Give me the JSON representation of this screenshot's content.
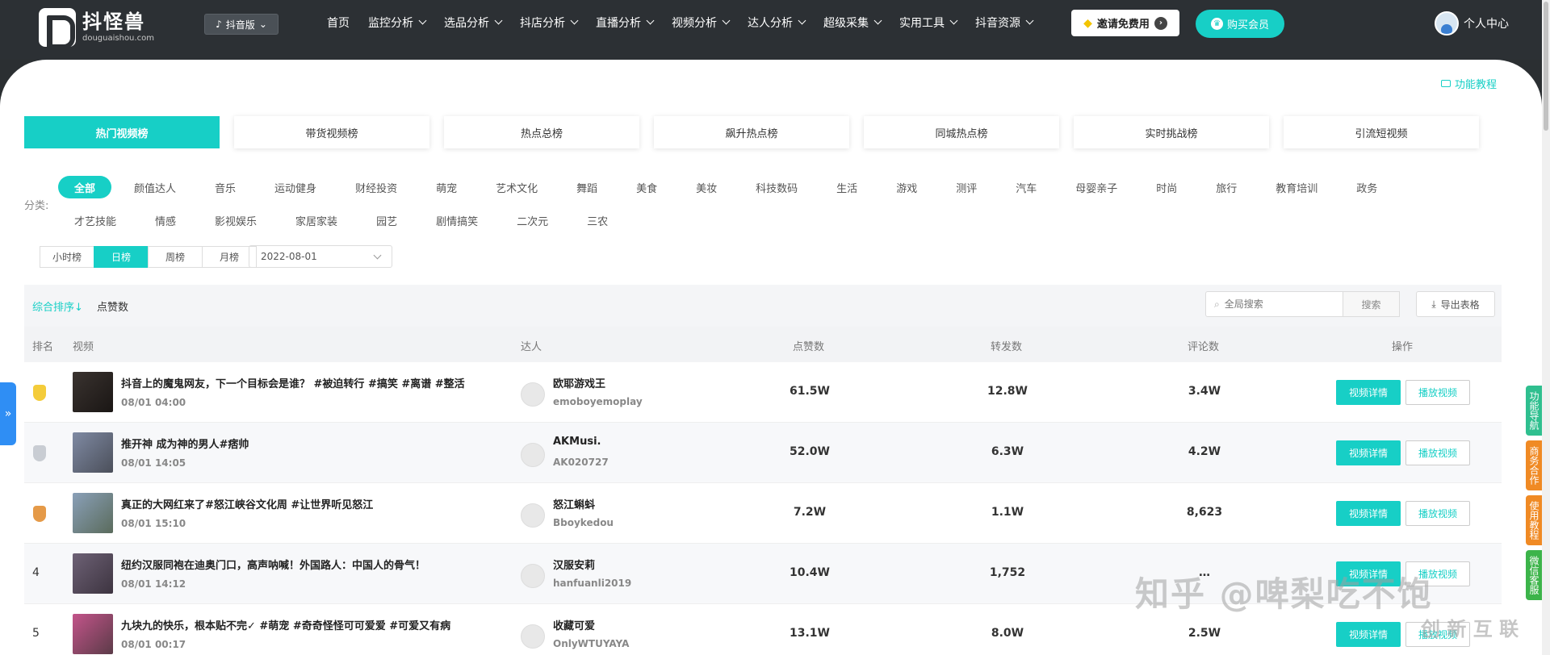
{
  "header": {
    "brand_name": "抖怪兽",
    "brand_url": "douguaishou.com",
    "platform": "抖音版",
    "nav": [
      "首页",
      "监控分析",
      "选品分析",
      "抖店分析",
      "直播分析",
      "视频分析",
      "达人分析",
      "超级采集",
      "实用工具",
      "抖音资源"
    ],
    "nav_has_caret": [
      false,
      true,
      true,
      true,
      true,
      true,
      true,
      true,
      true,
      true
    ],
    "invite_label": "邀请免费用",
    "buy_label": "购买会员",
    "user_label": "个人中心"
  },
  "tutorial_label": "功能教程",
  "rank_tabs": [
    "热门视频榜",
    "带货视频榜",
    "热点总榜",
    "飙升热点榜",
    "同城热点榜",
    "实时挑战榜",
    "引流短视频"
  ],
  "active_rank_tab": 0,
  "category_label": "分类:",
  "categories": [
    "全部",
    "颜值达人",
    "音乐",
    "运动健身",
    "财经投资",
    "萌宠",
    "艺术文化",
    "舞蹈",
    "美食",
    "美妆",
    "科技数码",
    "生活",
    "游戏",
    "测评",
    "汽车",
    "母婴亲子",
    "时尚",
    "旅行",
    "教育培训",
    "政务",
    "才艺技能",
    "情感",
    "影视娱乐",
    "家居家装",
    "园艺",
    "剧情搞笑",
    "二次元",
    "三农"
  ],
  "active_category": 0,
  "periods": [
    "小时榜",
    "日榜",
    "周榜",
    "月榜"
  ],
  "active_period": 1,
  "date_value": "2022-08-01",
  "toolbar": {
    "sort_composite": "综合排序↓",
    "sort_likes": "点赞数",
    "search_placeholder": "全局搜索",
    "search_button": "搜索",
    "export_button": "导出表格"
  },
  "table": {
    "headers": [
      "排名",
      "视频",
      "达人",
      "点赞数",
      "转发数",
      "评论数",
      "操作"
    ],
    "rows": [
      {
        "rank": "",
        "medal": "gold",
        "title": "抖音上的魔鬼网友，下一个目标会是谁？ #被迫转行 #搞笑 #离谱 #整活",
        "time": "08/01 04:00",
        "creator": "欧耶游戏王",
        "creator_id": "emoboyemoplay",
        "likes": "61.5W",
        "shares": "12.8W",
        "comments": "3.4W"
      },
      {
        "rank": "",
        "medal": "silver",
        "title": "推开神 成为神的男人#痞帅",
        "time": "08/01 14:05",
        "creator": "AKMusi.",
        "creator_id": "AK020727",
        "likes": "52.0W",
        "shares": "6.3W",
        "comments": "4.2W"
      },
      {
        "rank": "",
        "medal": "bronze",
        "title": "真正的大网红来了#怒江峡谷文化周 #让世界听见怒江",
        "time": "08/01 15:10",
        "creator": "怒江蝌蚪",
        "creator_id": "Bboykedou",
        "likes": "7.2W",
        "shares": "1.1W",
        "comments": "8,623"
      },
      {
        "rank": "4",
        "medal": "",
        "title": "纽约汉服同袍在迪奥门口，高声呐喊！外国路人：中国人的骨气！",
        "time": "08/01 14:12",
        "creator": "汉服安莉",
        "creator_id": "hanfuanli2019",
        "likes": "10.4W",
        "shares": "1,752",
        "comments": "…"
      },
      {
        "rank": "5",
        "medal": "",
        "title": "九块九的快乐，根本贴不完✓ #萌宠 #奇奇怪怪可可爱爱 #可爱又有病",
        "time": "08/01 00:17",
        "creator": "收藏可爱",
        "creator_id": "OnlyWTUYAYA",
        "likes": "13.1W",
        "shares": "8.0W",
        "comments": "2.5W"
      }
    ],
    "detail_button": "视频详情",
    "play_button": "播放视频"
  },
  "side_tabs": [
    {
      "label": "功能导航",
      "color": "#2fbf8f"
    },
    {
      "label": "商务合作",
      "color": "#f08a24"
    },
    {
      "label": "使用教程",
      "color": "#f08a24"
    },
    {
      "label": "微信客服",
      "color": "#3cb44a"
    }
  ],
  "watermark": "知乎 @啤梨吃不饱",
  "watermark_brand": "创 新 互 联",
  "colors": {
    "accent": "#17cfc6",
    "header_bg": "#2c3034"
  }
}
